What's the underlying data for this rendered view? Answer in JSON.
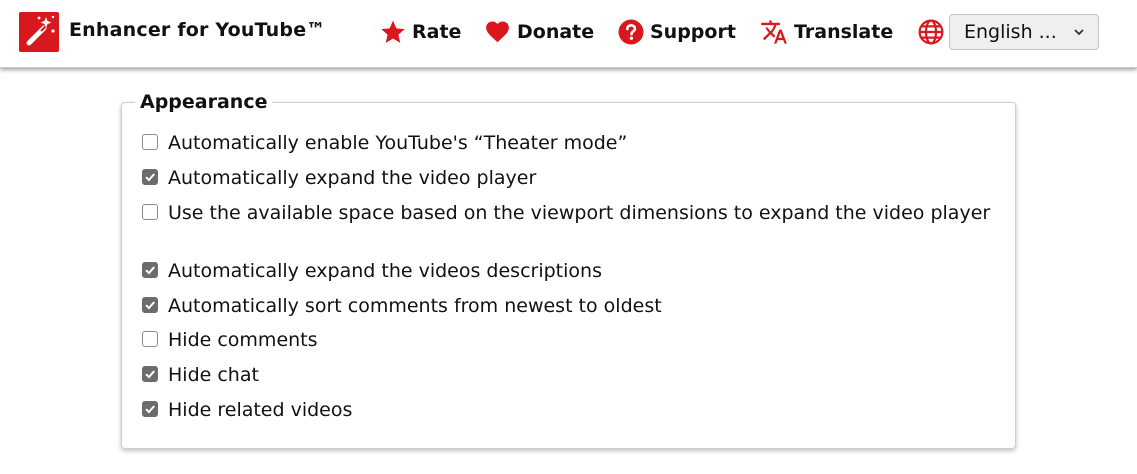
{
  "header": {
    "title": "Enhancer for YouTube™",
    "logo_icon": "magic-wand-icon",
    "accent_color": "#d8181c",
    "nav": {
      "rate": "Rate",
      "donate": "Donate",
      "support": "Support",
      "translate": "Translate"
    },
    "language": {
      "icon": "globe-icon",
      "selected": "English ..."
    }
  },
  "appearance": {
    "legend": "Appearance",
    "options": [
      {
        "label": "Automatically enable YouTube's “Theater mode”",
        "checked": false
      },
      {
        "label": "Automatically expand the video player",
        "checked": true
      },
      {
        "label": "Use the available space based on the viewport dimensions to expand the video player",
        "checked": false
      },
      {
        "label": "Automatically expand the videos descriptions",
        "checked": true
      },
      {
        "label": "Automatically sort comments from newest to oldest",
        "checked": true
      },
      {
        "label": "Hide comments",
        "checked": false
      },
      {
        "label": "Hide chat",
        "checked": true
      },
      {
        "label": "Hide related videos",
        "checked": true
      }
    ]
  }
}
